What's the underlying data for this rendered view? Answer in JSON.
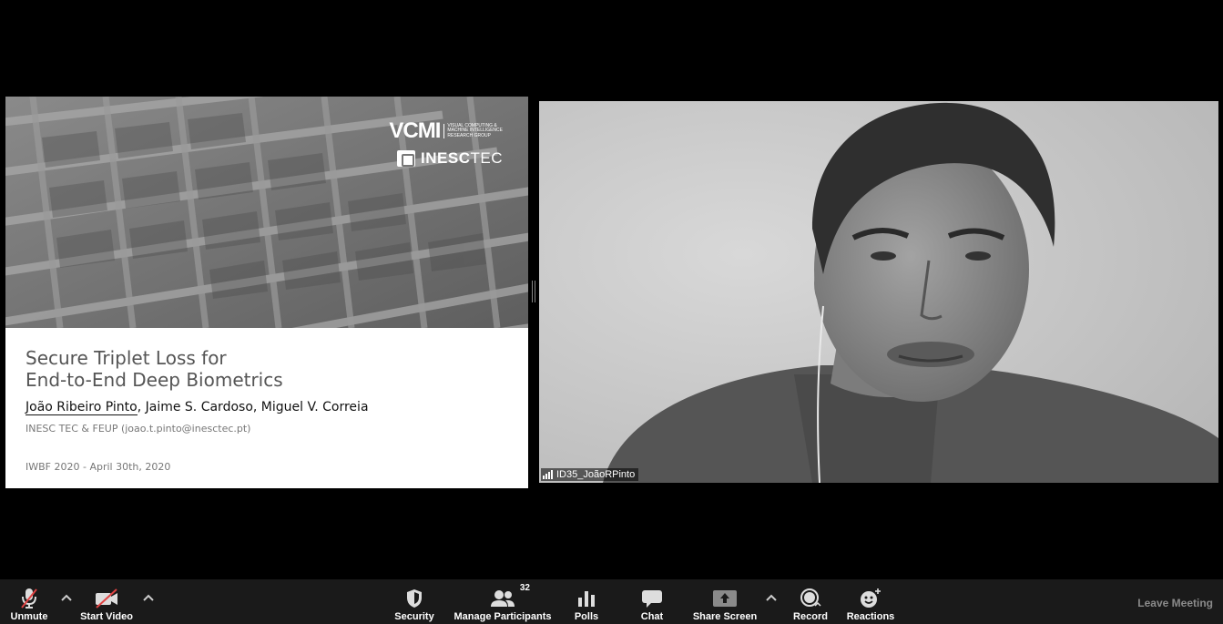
{
  "slide": {
    "logo_vcmi_mark": "VCMI",
    "logo_vcmi_text_1": "Visual Computing &",
    "logo_vcmi_text_2": "Machine Intelligence",
    "logo_vcmi_text_3": "Research Group",
    "logo_inesc_bold": "INESC",
    "logo_inesc_light": "TEC",
    "title_line1": "Secure Triplet Loss for",
    "title_line2": "End-to-End Deep Biometrics",
    "presenter": "João Ribeiro Pinto",
    "coauthors": ", Jaime S. Cardoso, Miguel V. Correia",
    "affiliation": "INESC TEC & FEUP (joao.t.pinto@inesctec.pt)",
    "event": "IWBF 2020 - April 30th, 2020"
  },
  "participant": {
    "name": "ID35_JoãoRPinto"
  },
  "toolbar": {
    "unmute": "Unmute",
    "start_video": "Start Video",
    "security": "Security",
    "manage_participants": "Manage Participants",
    "participant_count": "32",
    "polls": "Polls",
    "chat": "Chat",
    "share_screen": "Share Screen",
    "record": "Record",
    "reactions": "Reactions",
    "leave_meeting": "Leave Meeting"
  }
}
